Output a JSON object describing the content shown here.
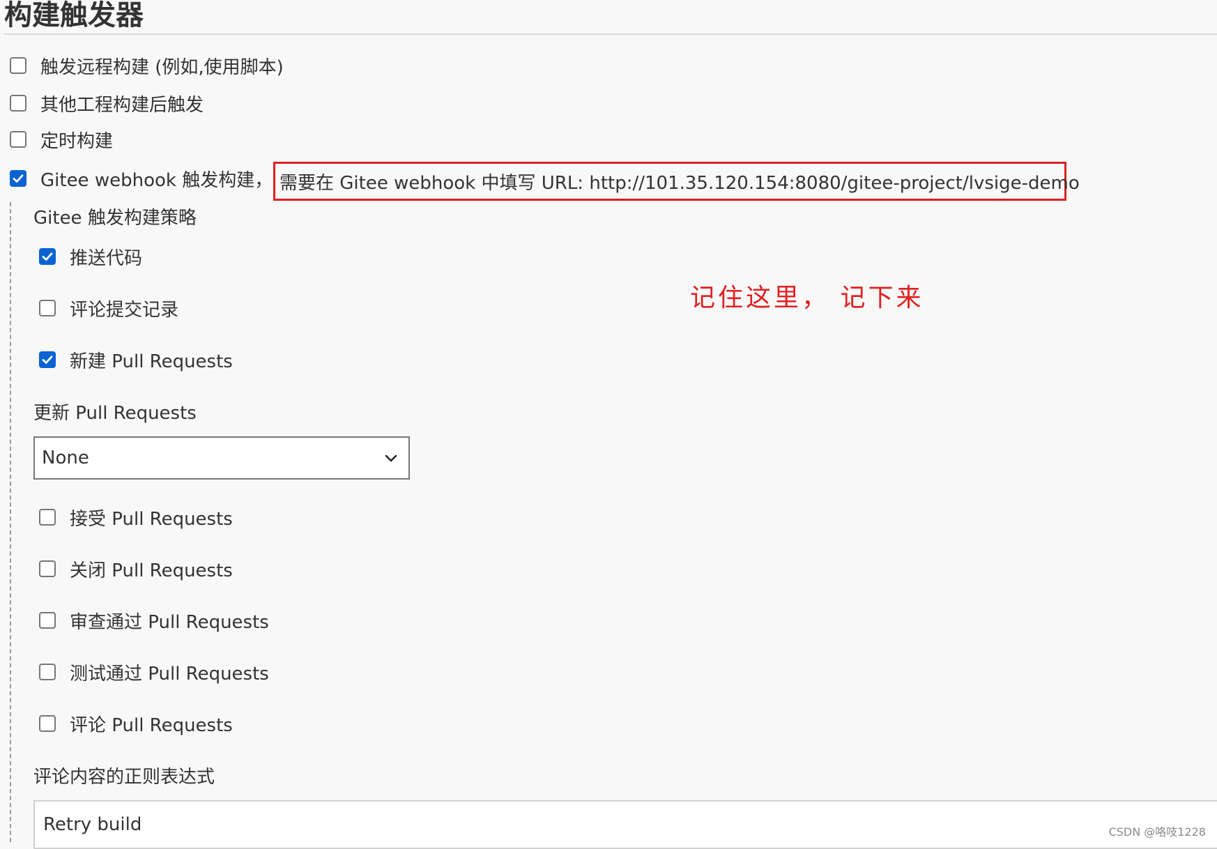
{
  "section": {
    "title": "构建触发器"
  },
  "triggers": [
    {
      "label": "触发远程构建 (例如,使用脚本)",
      "checked": false
    },
    {
      "label": "其他工程构建后触发",
      "checked": false
    },
    {
      "label": "定时构建",
      "checked": false
    },
    {
      "label": "Gitee webhook 触发构建，",
      "checked": true
    }
  ],
  "gitee_webhook": {
    "url_hint": "需要在 Gitee webhook 中填写 URL: http://101.35.120.154:8080/gitee-project/lvsige-demo"
  },
  "strategy": {
    "heading": "Gitee 触发构建策略",
    "options_top": [
      {
        "label": "推送代码",
        "checked": true
      },
      {
        "label": "评论提交记录",
        "checked": false
      },
      {
        "label": "新建 Pull Requests",
        "checked": true
      }
    ],
    "update_pr": {
      "label": "更新 Pull Requests",
      "selected": "None"
    },
    "options_bottom": [
      {
        "label": "接受 Pull Requests",
        "checked": false
      },
      {
        "label": "关闭 Pull Requests",
        "checked": false
      },
      {
        "label": "审查通过 Pull Requests",
        "checked": false
      },
      {
        "label": "测试通过 Pull Requests",
        "checked": false
      },
      {
        "label": "评论 Pull Requests",
        "checked": false
      }
    ],
    "comment_regex": {
      "label": "评论内容的正则表达式",
      "value": "Retry build"
    }
  },
  "annotation": {
    "note": "记住这里， 记下来"
  },
  "watermark": "CSDN @咯吱1228"
}
